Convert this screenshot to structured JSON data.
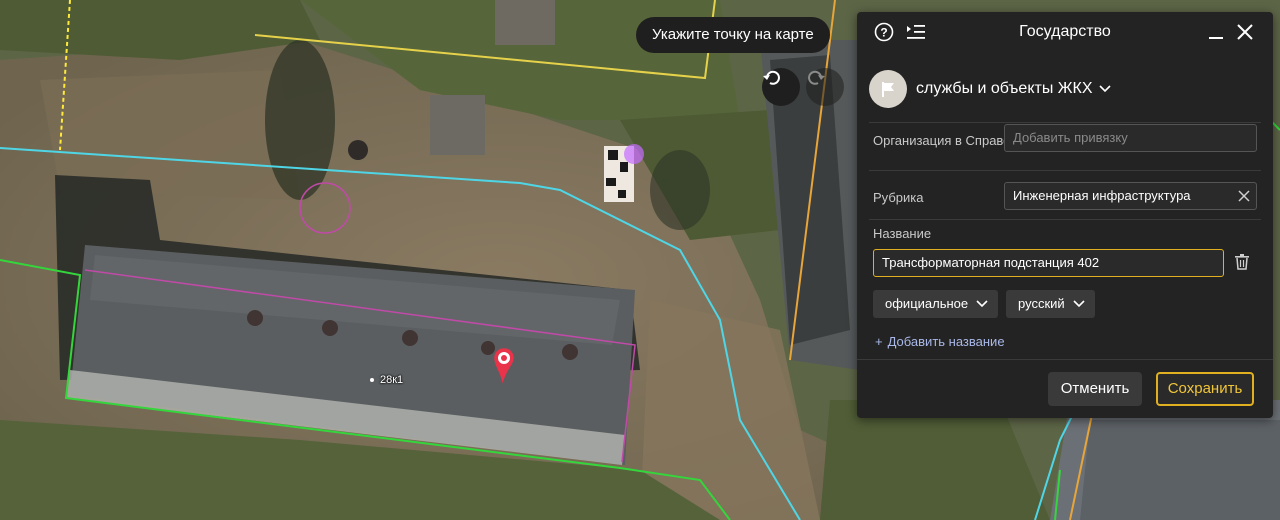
{
  "map": {
    "hint": "Укажите точку на карте",
    "house_label": "28к1"
  },
  "panel": {
    "title": "Государство",
    "category": "службы и объекты ЖКХ",
    "org_label": "Организация в Справочнике",
    "org_placeholder": "Добавить привязку",
    "rubric_label": "Рубрика",
    "rubric_value": "Инженерная инфраструктура",
    "name_label": "Название",
    "name_value": "Трансформаторная подстанция 402",
    "name_type": "официальное",
    "name_lang": "русский",
    "add_name": "Добавить название",
    "cancel": "Отменить",
    "save": "Сохранить"
  },
  "colors": {
    "accent": "#e0b020",
    "panel_bg": "#232323",
    "link": "#a9b8e8"
  },
  "icons": [
    "help-icon",
    "layers-list-icon",
    "minimize-icon",
    "close-icon",
    "undo-icon",
    "redo-icon",
    "flag-icon",
    "chevron-down-icon",
    "clear-icon",
    "trash-icon",
    "map-pin-icon"
  ]
}
